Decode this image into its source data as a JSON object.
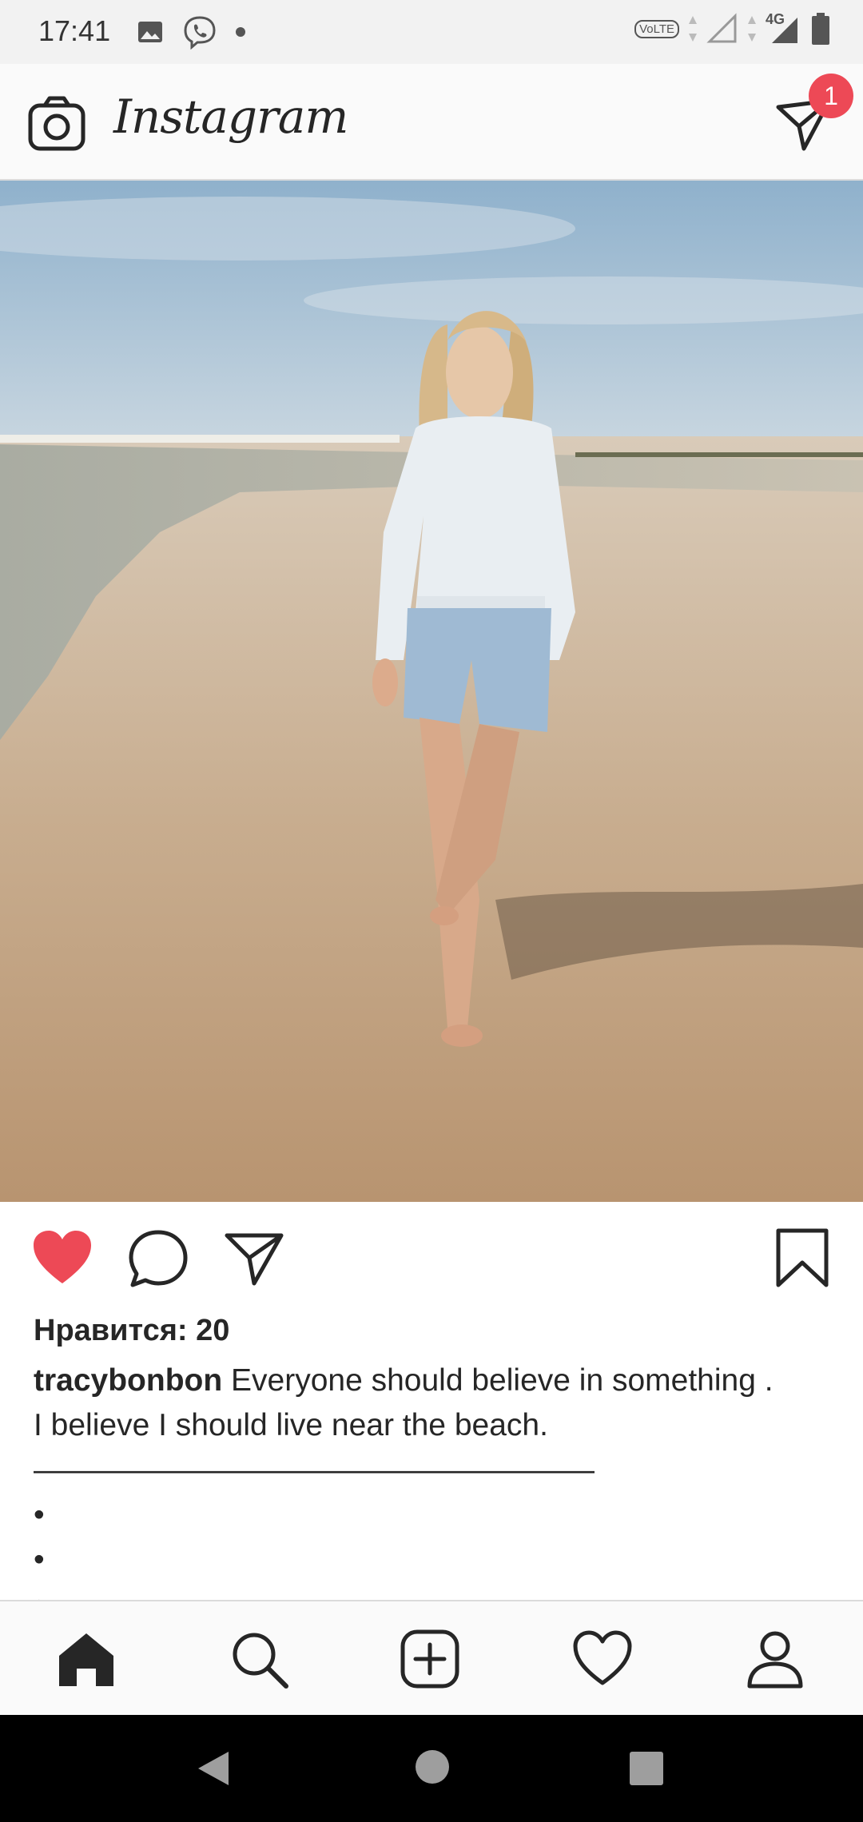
{
  "status_bar": {
    "time": "17:41",
    "icons_left": [
      "image-icon",
      "viber-icon",
      "dot-icon"
    ],
    "volte_label": "VoLTE",
    "network_label": "4G",
    "icons_right": [
      "volte-icon",
      "signal-icon",
      "signal-4g-icon",
      "battery-icon"
    ]
  },
  "header": {
    "brand": "Instagram",
    "direct_badge_count": "1"
  },
  "post": {
    "photo_alt": "Woman in white knit sweater and denim shorts walking barefoot on a sandy beach",
    "likes_label": "Нравится: 20",
    "username": "tracybonbon",
    "caption_text": " Everyone should believe in something .",
    "caption_line2": "I believe I should live near the beach.",
    "caption_line3": "——————————————————",
    "caption_dot1": "•",
    "caption_dot2": "•",
    "caption_dot3": "•"
  },
  "colors": {
    "like_red": "#ed4956",
    "text": "#262626",
    "divider": "#dbdbdb"
  }
}
